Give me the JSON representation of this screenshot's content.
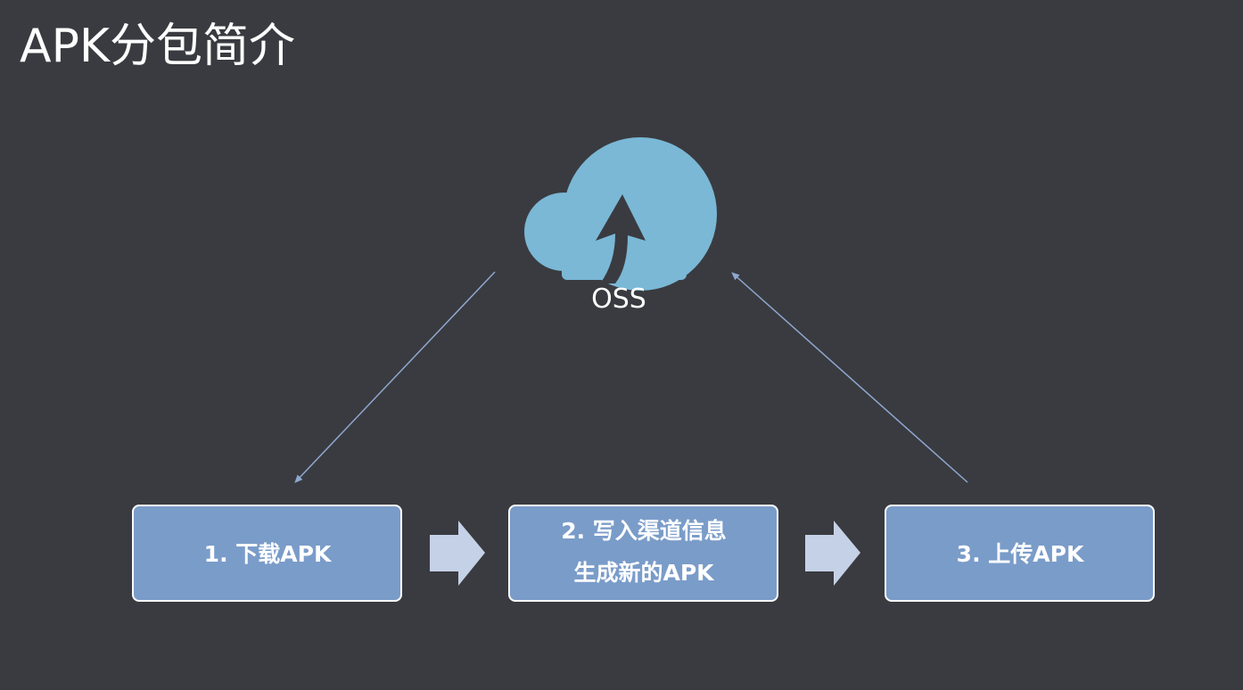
{
  "title": "APK分包简介",
  "cloud": {
    "label": "OSS",
    "icon": "cloud-upload-icon",
    "color": "#7ab8d6"
  },
  "steps": [
    {
      "lines": [
        "1. 下载APK"
      ]
    },
    {
      "lines": [
        "2. 写入渠道信息",
        "生成新的APK"
      ]
    },
    {
      "lines": [
        "3. 上传APK"
      ]
    }
  ],
  "colors": {
    "background": "#3a3b40",
    "box_fill": "#7a9cc9",
    "box_border": "#ffffff",
    "connector": "#8fa8d0",
    "flow_arrow": "#c5d1e6"
  }
}
